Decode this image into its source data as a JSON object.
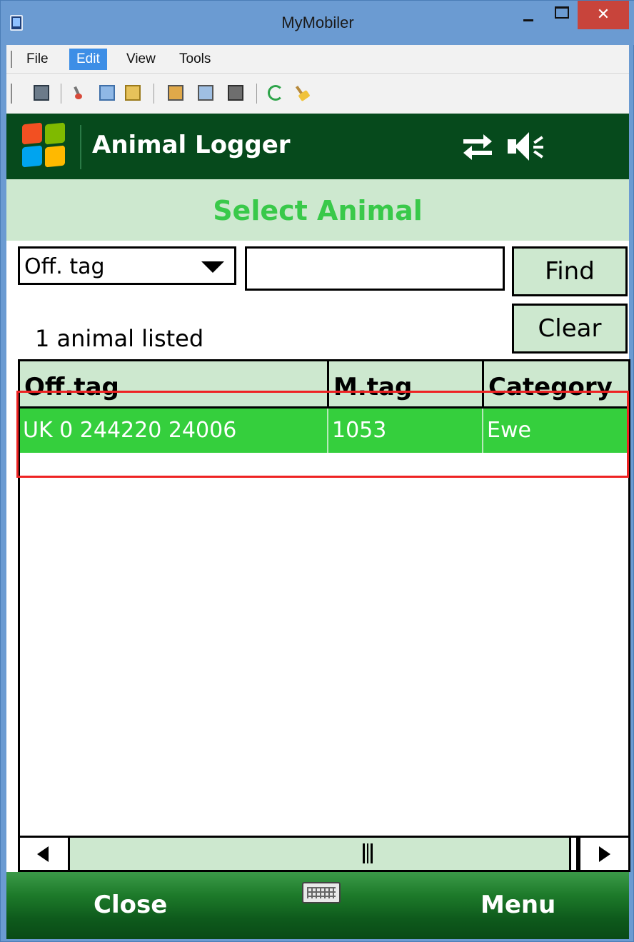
{
  "window": {
    "title": "MyMobiler",
    "close_glyph": "✕"
  },
  "menubar": {
    "items": [
      "File",
      "Edit",
      "View",
      "Tools"
    ],
    "selected": "Edit"
  },
  "toolbar": {
    "icons": [
      "device-icon",
      "cut-icon",
      "copy-icon",
      "paste-icon",
      "screen1-icon",
      "screen2-icon",
      "screen3-icon",
      "refresh-icon",
      "clean-icon"
    ]
  },
  "app": {
    "title": "Animal Logger",
    "screen_title": "Select Animal",
    "search_field": "Off. tag",
    "search_value": "",
    "find_label": "Find",
    "clear_label": "Clear",
    "count_text": "1 animal listed",
    "columns": [
      "Off.tag",
      "M.tag",
      "Category"
    ],
    "rows": [
      [
        "UK 0 244220 24006",
        "1053",
        "Ewe"
      ]
    ],
    "soft_left": "Close",
    "soft_right": "Menu"
  },
  "colors": {
    "header_bg": "#064a1c",
    "accent_green": "#35cf3d",
    "light_green": "#cde8cf",
    "highlight": "#e22222"
  }
}
